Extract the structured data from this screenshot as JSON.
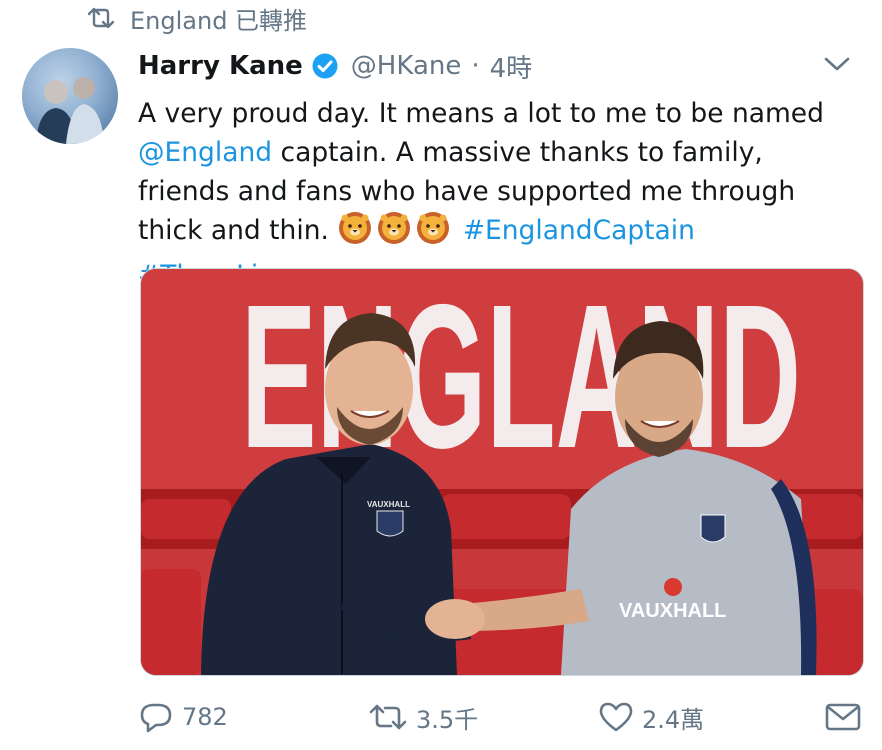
{
  "retweet_context": {
    "icon": "retweet-icon",
    "text": "England 已轉推"
  },
  "tweet": {
    "author_name": "Harry Kane",
    "verified_icon": "verified-badge-icon",
    "handle": "@HKane",
    "separator": "·",
    "timestamp": "4時",
    "text": {
      "line1": "A very proud day. It means a lot to me to be named",
      "mention": "@England",
      "line2_rest": " captain. A massive thanks to family, friends and fans who have supported me through thick and thin.",
      "hashtag1": "#EnglandCaptain",
      "hashtag2": "#ThreeLions"
    },
    "emojis": [
      "lion-face-icon",
      "lion-face-icon",
      "lion-face-icon"
    ],
    "media": {
      "banner_text": "ENGLAND",
      "shirt_sponsor": "VAUXHALL",
      "small_sponsor": "VAUXHALL"
    }
  },
  "actions": {
    "reply_count": "782",
    "retweet_count": "3.5千",
    "like_count": "2.4萬"
  },
  "colors": {
    "link": "#1b95e0",
    "secondary_text": "#657786",
    "banner_red": "#c8373a",
    "seat_red": "#b92226"
  }
}
